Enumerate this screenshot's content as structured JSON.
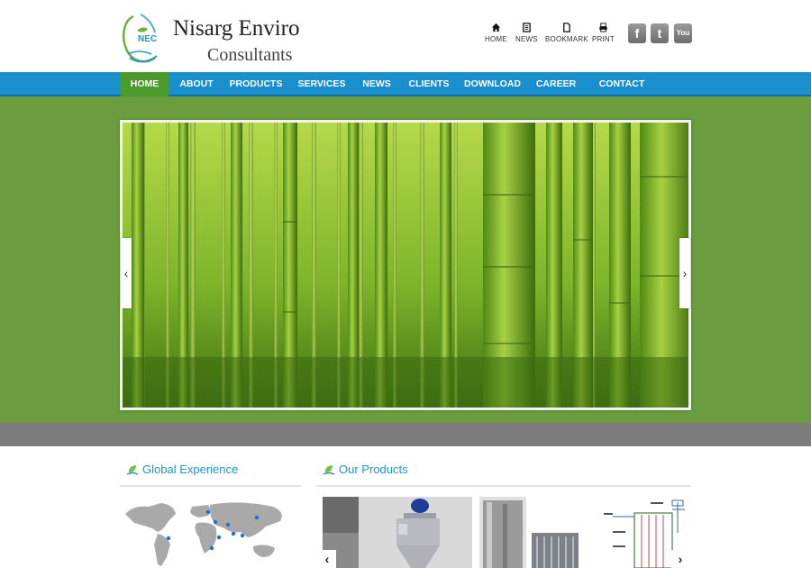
{
  "header": {
    "logo_mark": "NEC",
    "logo_title": "Nisarg Enviro",
    "logo_subtitle": "Consultants",
    "utility": [
      {
        "label": "HOME",
        "icon": "home-icon"
      },
      {
        "label": "NEWS",
        "icon": "news-icon"
      },
      {
        "label": "BOOKMARK",
        "icon": "bookmark-icon"
      },
      {
        "label": "PRINT",
        "icon": "print-icon"
      }
    ],
    "social": [
      {
        "label": "f",
        "icon": "facebook-icon"
      },
      {
        "label": "t",
        "icon": "twitter-icon"
      },
      {
        "label": "You Tube",
        "icon": "youtube-icon"
      }
    ]
  },
  "nav": {
    "items": [
      "HOME",
      "ABOUT",
      "PRODUCTS",
      "SERVICES",
      "NEWS",
      "CLIENTS",
      "DOWNLOAD",
      "CAREER",
      "CONTACT US"
    ],
    "active": "HOME"
  },
  "slider": {
    "prev": "‹",
    "next": "›",
    "image": "bamboo-forest-photo"
  },
  "sections": {
    "global_experience": "Global Experience",
    "our_products": "Our Products"
  },
  "carousel": {
    "prev": "‹",
    "next": "›"
  },
  "colors": {
    "nav_blue": "#1a8fcd",
    "nav_active_green": "#4a9a2c",
    "banner_green": "#6b9d3e",
    "section_title_blue": "#1b97cf",
    "band_gray": "#7c7c7c"
  }
}
